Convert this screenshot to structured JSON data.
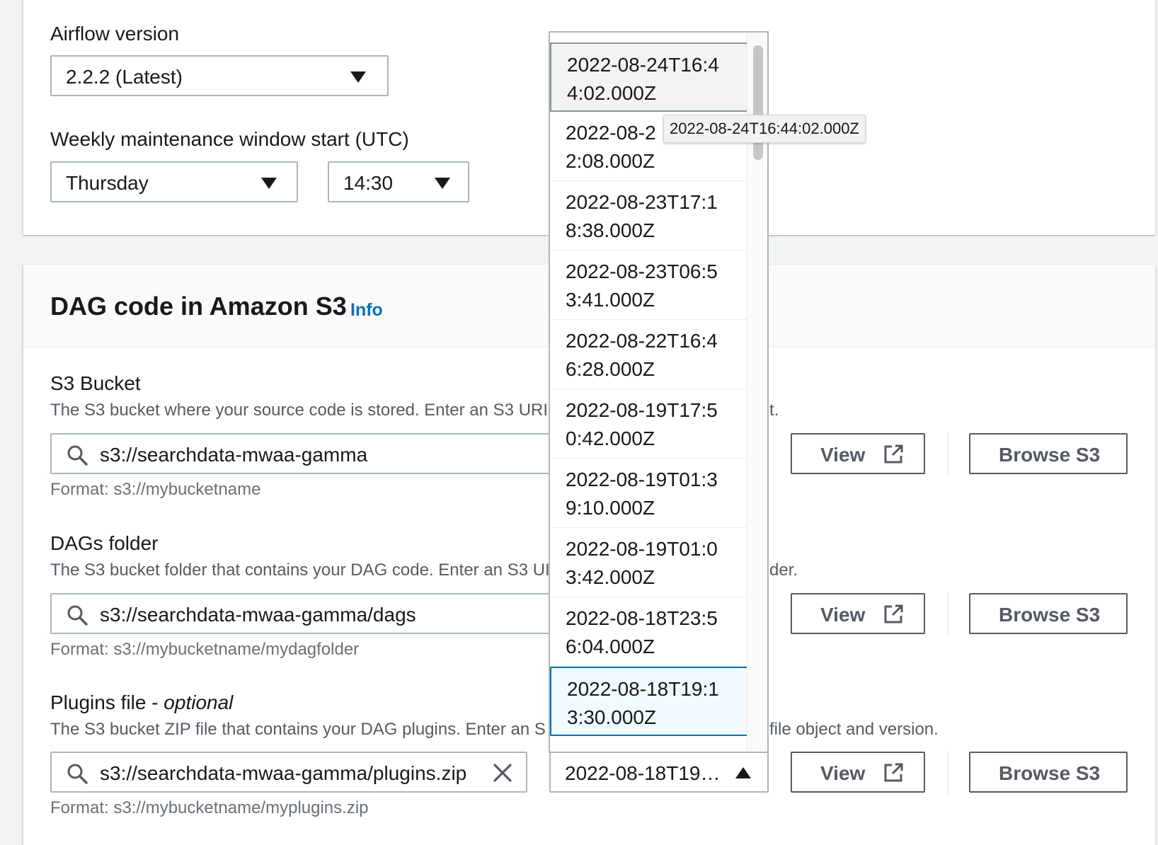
{
  "environment": {
    "airflow_version": {
      "label": "Airflow version",
      "value": "2.2.2 (Latest)"
    },
    "maintenance": {
      "label": "Weekly maintenance window start (UTC)",
      "day": "Thursday",
      "time": "14:30"
    }
  },
  "dag_section": {
    "title": "DAG code in Amazon S3",
    "info_link": "Info",
    "s3_bucket": {
      "label": "S3 Bucket",
      "description_left": "The S3 bucket where your source code is stored. Enter an S3 URI",
      "description_right": "t.",
      "value": "s3://searchdata-mwaa-gamma",
      "format": "Format: s3://mybucketname",
      "view_label": "View",
      "browse_label": "Browse S3"
    },
    "dags_folder": {
      "label": "DAGs folder",
      "description_left": "The S3 bucket folder that contains your DAG code. Enter an S3 UI",
      "description_right": "der.",
      "value": "s3://searchdata-mwaa-gamma/dags",
      "format": "Format: s3://mybucketname/mydagfolder",
      "view_label": "View",
      "browse_label": "Browse S3"
    },
    "plugins_file": {
      "label": "Plugins file - ",
      "label_optional": "optional",
      "description_left": "The S3 bucket ZIP file that contains your DAG plugins. Enter an S",
      "description_right": "file object and version.",
      "value": "s3://searchdata-mwaa-gamma/plugins.zip",
      "format": "Format: s3://mybucketname/myplugins.zip",
      "version_value": "2022-08-18T19…",
      "view_label": "View",
      "browse_label": "Browse S3"
    }
  },
  "version_dropdown": {
    "options": [
      {
        "line1": "2022-08-24T16:4",
        "line2": "4:02.000Z"
      },
      {
        "line1": "2022-08-2",
        "line2": "2:08.000Z"
      },
      {
        "line1": "2022-08-23T17:1",
        "line2": "8:38.000Z"
      },
      {
        "line1": "2022-08-23T06:5",
        "line2": "3:41.000Z"
      },
      {
        "line1": "2022-08-22T16:4",
        "line2": "6:28.000Z"
      },
      {
        "line1": "2022-08-19T17:5",
        "line2": "0:42.000Z"
      },
      {
        "line1": "2022-08-19T01:3",
        "line2": "9:10.000Z"
      },
      {
        "line1": "2022-08-19T01:0",
        "line2": "3:42.000Z"
      },
      {
        "line1": "2022-08-18T23:5",
        "line2": "6:04.000Z"
      },
      {
        "line1": "2022-08-18T19:1",
        "line2": "3:30.000Z"
      }
    ],
    "tooltip": "2022-08-24T16:44:02.000Z"
  },
  "icons": {
    "search": "search-icon",
    "external_link": "external-link-icon",
    "clear": "close-icon",
    "caret_down": "caret-down-icon",
    "caret_up": "caret-up-icon"
  },
  "colors": {
    "link": "#0073bb",
    "border": "#aab7b8",
    "button_text": "#545b64",
    "selected_bg": "#f1faff"
  }
}
